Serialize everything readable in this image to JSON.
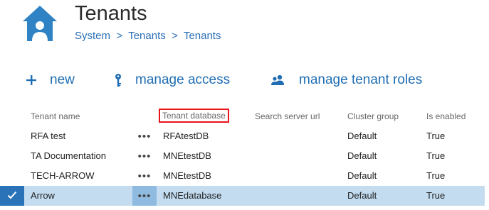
{
  "header": {
    "title": "Tenants",
    "breadcrumb": [
      "System",
      ">",
      "Tenants",
      ">",
      "Tenants"
    ]
  },
  "toolbar": {
    "new_label": "new",
    "manage_access_label": "manage access",
    "manage_roles_label": "manage tenant roles"
  },
  "table": {
    "headers": {
      "name": "Tenant name",
      "database": "Tenant database",
      "search_url": "Search server url",
      "cluster": "Cluster group",
      "enabled": "Is enabled"
    },
    "rows": [
      {
        "name": "RFA test",
        "menu": "•••",
        "database": "RFAtestDB",
        "search_url": "",
        "cluster": "Default",
        "enabled": "True"
      },
      {
        "name": "TA Documentation",
        "menu": "•••",
        "database": "MNEtestDB",
        "search_url": "",
        "cluster": "Default",
        "enabled": "True"
      },
      {
        "name": "TECH-ARROW",
        "menu": "•••",
        "database": "MNEtestDB",
        "search_url": "",
        "cluster": "Default",
        "enabled": "True"
      },
      {
        "name": "Arrow",
        "menu": "•••",
        "database": "MNEdatabase",
        "search_url": "",
        "cluster": "Default",
        "enabled": "True"
      }
    ]
  },
  "icons": {
    "home": "home-user-icon",
    "new": "plus-icon",
    "access": "key-icon",
    "roles": "users-icon",
    "selected": "checkmark-icon"
  },
  "colors": {
    "accent": "#1f6db3",
    "selected_row": "#c3dcf0",
    "highlight_border": "#e8141b"
  }
}
